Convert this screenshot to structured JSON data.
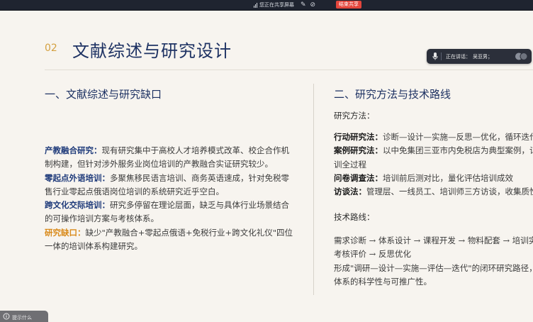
{
  "share_bar": {
    "status_text": "您正在共享屏幕",
    "end_button_label": "结束共享",
    "icons": [
      "signal-icon",
      "annotate-icon",
      "hide-icon"
    ]
  },
  "slide": {
    "number": "02",
    "title": "文献综述与研究设计",
    "left": {
      "heading": "一、文献综述与研究缺口",
      "paragraphs": [
        {
          "label": "产教融合研究：",
          "text": "现有研究集中于高校人才培养模式改革、校企合作机制构建，但针对涉外服务业岗位培训的产教融合实证研究较少。"
        },
        {
          "label": "零起点外语培训：",
          "text": "多聚焦移民语言培训、商务英语速成，针对免税零售行业零起点俄语岗位培训的系统研究近乎空白。"
        },
        {
          "label": "跨文化交际培训：",
          "text": "研究多停留在理论层面，缺乏与具体行业场景结合的可操作培训方案与考核体系。"
        },
        {
          "label": "研究缺口：",
          "text": "缺少\"产教融合+零起点俄语+免税行业+跨文化礼仪\"四位一体的培训体系构建研究。"
        }
      ]
    },
    "right": {
      "heading": "二、研究方法与技术路线",
      "methods_title": "研究方法：",
      "methods": [
        {
          "label": "行动研究法：",
          "text": "诊断—设计—实施—反思—优化，循环迭代"
        },
        {
          "label": "案例研究法：",
          "text": "以中免集团三亚市内免税店为典型案例，记录培"
        },
        {
          "label": "",
          "text": "训全过程"
        },
        {
          "label": "问卷调查法：",
          "text": "培训前后测对比，量化评估培训成效"
        },
        {
          "label": "访谈法：",
          "text": "管理层、一线员工、培训师三方访谈，收集质性"
        }
      ],
      "roadmap_title": "技术路线：",
      "roadmap_lines": [
        "需求诊断 → 体系设计 → 课程开发 → 物料配套 → 培训实施",
        "考核评价 → 反思优化",
        "形成\"调研—设计—实施—评估—迭代\"的闭环研究路径，确保",
        "体系的科学性与可推广性。"
      ]
    }
  },
  "speaker": {
    "label": "正在讲话：",
    "name": "吴亚男；"
  },
  "toast": {
    "text": "提示什么"
  },
  "colors": {
    "title_navy": "#1e3263",
    "label_blue": "#1e3a7a",
    "label_orange": "#d98a1a",
    "slide_number_gold": "#d4a040",
    "end_share_red": "#e4463c"
  }
}
